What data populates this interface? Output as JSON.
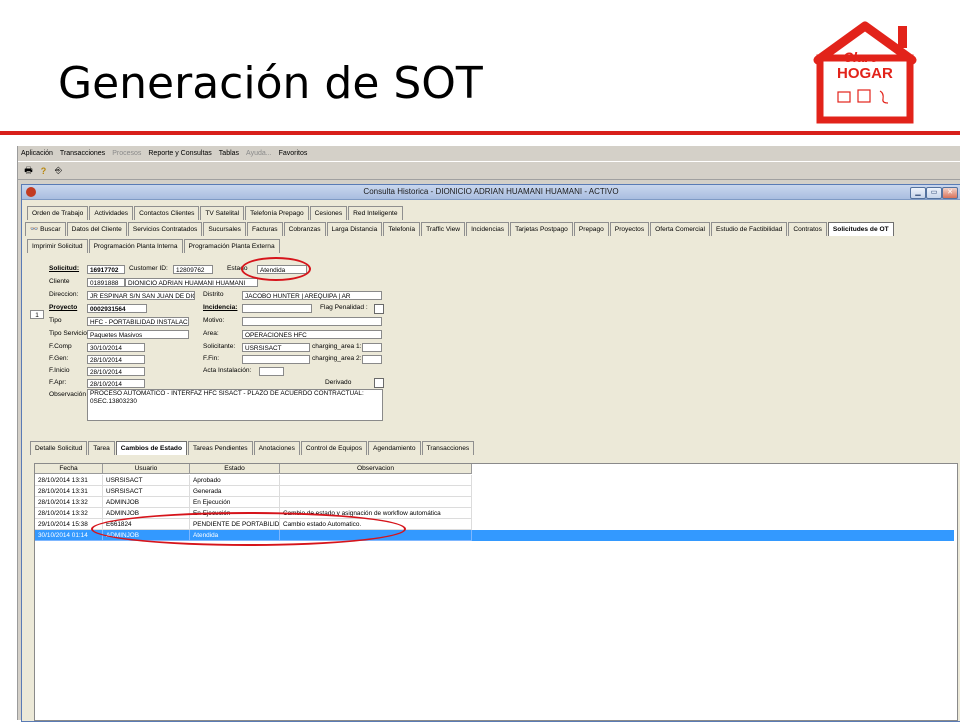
{
  "slide": {
    "title": "Generación de SOT"
  },
  "logo": {
    "line1": "Claro",
    "line2": "HOGAR"
  },
  "menu": [
    "Aplicación",
    "Transacciones",
    "Procesos",
    "Reporte y Consultas",
    "Tablas",
    "Ayuda...",
    "Favoritos"
  ],
  "window": {
    "title": "Consulta Historica - DIONICIO ADRIAN HUAMANI HUAMANI - ACTIVO"
  },
  "tabs_row1": [
    "Orden de Trabajo",
    "Actividades",
    "Contactos Clientes",
    "TV Satelital",
    "Telefonía Prepago",
    "Cesiones",
    "Red Inteligente"
  ],
  "tabs_row2": [
    "Buscar",
    "Datos del Cliente",
    "Servicios Contratados",
    "Sucursales",
    "Facturas",
    "Cobranzas",
    "Larga Distancia",
    "Telefonía",
    "Traffic View",
    "Incidencias",
    "Tarjetas Postpago",
    "Prepago",
    "Proyectos",
    "Oferta Comercial",
    "Estudio de Factibilidad",
    "Contratos",
    "Solicitudes de OT"
  ],
  "tabs_row3": [
    "Imprimir Solicitud",
    "Programación Planta Interna",
    "Programación Planta Externa"
  ],
  "form": {
    "solicitud_label": "Solicitud:",
    "solicitud": "16917702",
    "customer_label": "Customer ID:",
    "customer": "12809762",
    "estado_label": "Estado",
    "estado": "Atendida",
    "cliente_label": "Cliente",
    "cliente_code": "01891888",
    "cliente_name": "DIONICIO ADRIAN HUAMANI HUAMANI",
    "direccion_label": "Direccion:",
    "direccion": "JR ESPINAR S/N  SAN JUAN DE DIOS",
    "distrito_label": "Distrito",
    "distrito": "JACOBO HUNTER | AREQUIPA | AR",
    "proyecto_label": "Proyecto",
    "proyecto": "0002931564",
    "incidencia_label": "Incidencia:",
    "flag_label": "Flag Penalidad :",
    "tipo_label": "Tipo",
    "tipo": "HFC - PORTABILIDAD INSTALACION",
    "motivo_label": "Motivo:",
    "tipo_servicio_label": "Tipo Servicio",
    "tipo_servicio": "Paquetes Masivos",
    "area_label": "Area:",
    "area": "OPERACIONES HFC",
    "fcomp_label": "F.Comp",
    "fcomp": "30/10/2014",
    "solicitante_label": "Solicitante:",
    "solicitante": "USRSISACT",
    "ch1_label": "charging_area 1:",
    "fgen_label": "F.Gen:",
    "fgen": "28/10/2014",
    "ffin_label": "F.Fin:",
    "ch2_label": "charging_area 2:",
    "finicio_label": "F.Inicio",
    "finicio": "28/10/2014",
    "acta_label": "Acta Instalación:",
    "fapr_label": "F.Apr:",
    "fapr": "28/10/2014",
    "derivado_label": "Derivado",
    "obs_label": "Observación",
    "obs_line1": "PROCESO AUTOMATICO - INTERFAZ HFC SISACT - PLAZO DE ACUERDO CONTRACTUAL:",
    "obs_line2": "0SEC.13803230",
    "side_number": "1"
  },
  "tabs_bottom": [
    "Detalle Solicitud",
    "Tarea",
    "Cambios de Estado",
    "Tareas Pendientes",
    "Anotaciones",
    "Control de Equipos",
    "Agendamiento",
    "Transacciones"
  ],
  "grid": {
    "headers": [
      "Fecha",
      "Usuario",
      "Estado",
      "Observacion"
    ],
    "rows": [
      [
        "28/10/2014 13:31",
        "USRSISACT",
        "Aprobado",
        ""
      ],
      [
        "28/10/2014 13:31",
        "USRSISACT",
        "Generada",
        ""
      ],
      [
        "28/10/2014 13:32",
        "ADMINJOB",
        "En Ejecución",
        ""
      ],
      [
        "28/10/2014 13:32",
        "ADMINJOB",
        "En Ejecución",
        "Cambio de estado y asignación de workflow automática"
      ],
      [
        "29/10/2014 15:38",
        "E661824",
        "PENDIENTE DE PORTABILIDAD",
        "Cambio estado Automatico."
      ],
      [
        "30/10/2014 01:14",
        "ADMINJOB",
        "Atendida",
        ""
      ]
    ]
  },
  "colors": {
    "accent_red": "#d8201a",
    "selection": "#3399ff"
  }
}
